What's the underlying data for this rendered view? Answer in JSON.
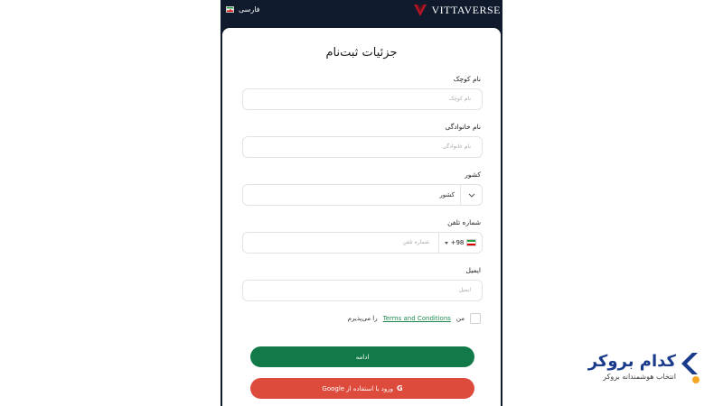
{
  "topbar": {
    "language": "فارسی",
    "brand": "VITTAVERSE"
  },
  "form": {
    "title": "جزئیات ثبت‌نام",
    "first_name": {
      "label": "نام کوچک",
      "placeholder": "نام کوچک"
    },
    "last_name": {
      "label": "نام خانوادگی",
      "placeholder": "نام خانوادگی"
    },
    "country": {
      "label": "کشور",
      "value": "کشور"
    },
    "phone": {
      "label": "شماره تلفن",
      "prefix": "+98",
      "placeholder": "شماره تلفن"
    },
    "email": {
      "label": "ایمیل",
      "placeholder": "ایمیل"
    },
    "terms": {
      "prefix": "من",
      "link": "Terms and Conditions",
      "suffix": "را می‌پذیرم"
    },
    "continue_label": "ادامه",
    "google_label": "ورود با استفاده از Google",
    "google_icon": "G"
  },
  "watermark": {
    "title": "کدام بروکر",
    "subtitle": "انتخاب هوشمندانه بروکر"
  },
  "colors": {
    "topbar_bg": "#0f1b2d",
    "primary_green": "#117a48",
    "google_red": "#dd4b3c",
    "brand_red": "#b0182a",
    "watermark_blue": "#1a3a8c",
    "watermark_orange": "#f5a623"
  }
}
